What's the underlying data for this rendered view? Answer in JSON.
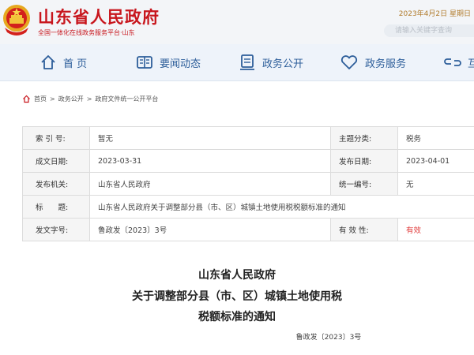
{
  "header": {
    "site_title": "山东省人民政府",
    "subtitle": "全国一体化在线政务服务平台·山东",
    "date": "2023年4月2日 星期日",
    "search_placeholder": "请输入关键字查询"
  },
  "nav": [
    {
      "label": "首 页",
      "icon": "home-icon"
    },
    {
      "label": "要闻动态",
      "icon": "newspaper-icon"
    },
    {
      "label": "政务公开",
      "icon": "document-stamp-icon"
    },
    {
      "label": "政务服务",
      "icon": "heart-icon"
    },
    {
      "label": "互",
      "icon": "link-icon"
    }
  ],
  "breadcrumb": [
    "首页",
    "政务公开",
    "政府文件统一公开平台"
  ],
  "meta": {
    "index_label": "索 引 号:",
    "index_value": "暂无",
    "topic_label": "主题分类:",
    "topic_value": "税务",
    "created_label": "成文日期:",
    "created_value": "2023-03-31",
    "published_label": "发布日期:",
    "published_value": "2023-04-01",
    "agency_label": "发布机关:",
    "agency_value": "山东省人民政府",
    "serial_label": "统一编号:",
    "serial_value": "无",
    "title_label": "标　　题:",
    "title_value": "山东省人民政府关于调整部分县（市、区）城镇土地使用税税额标准的通知",
    "docno_label": "发文字号:",
    "docno_value": "鲁政发〔2023〕3号",
    "validity_label": "有 效 性:",
    "validity_value": "有效"
  },
  "document": {
    "issuer": "山东省人民政府",
    "title_line1": "关于调整部分县（市、区）城镇土地使用税",
    "title_line2": "税额标准的通知",
    "doc_number": "鲁政发〔2023〕3号"
  },
  "colors": {
    "brand_red": "#c8161d",
    "nav_blue": "#2d5e9a",
    "valid_red": "#e03a3a"
  }
}
